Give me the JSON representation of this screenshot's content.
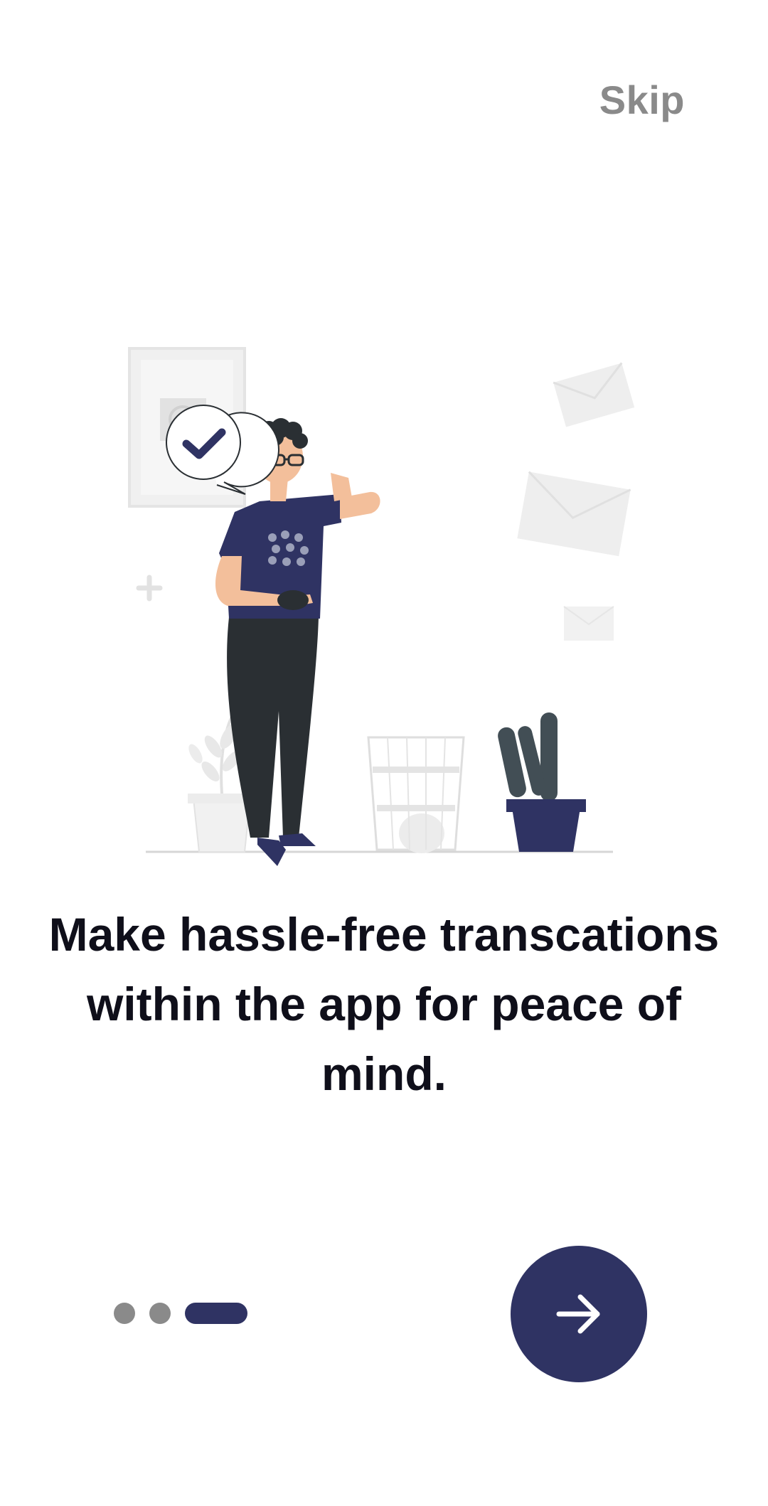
{
  "header": {
    "skip_label": "Skip"
  },
  "onboarding": {
    "headline_line1": "Make hassle-free transcations",
    "headline_line2": "within the app for peace of",
    "headline_line3": "mind.",
    "current_page": 3,
    "total_pages": 3
  },
  "next_button": {
    "icon": "arrow-right-icon"
  },
  "colors": {
    "accent": "#2f3363",
    "muted": "#8a8a8a",
    "text": "#0f0f1a",
    "background": "#ffffff"
  }
}
